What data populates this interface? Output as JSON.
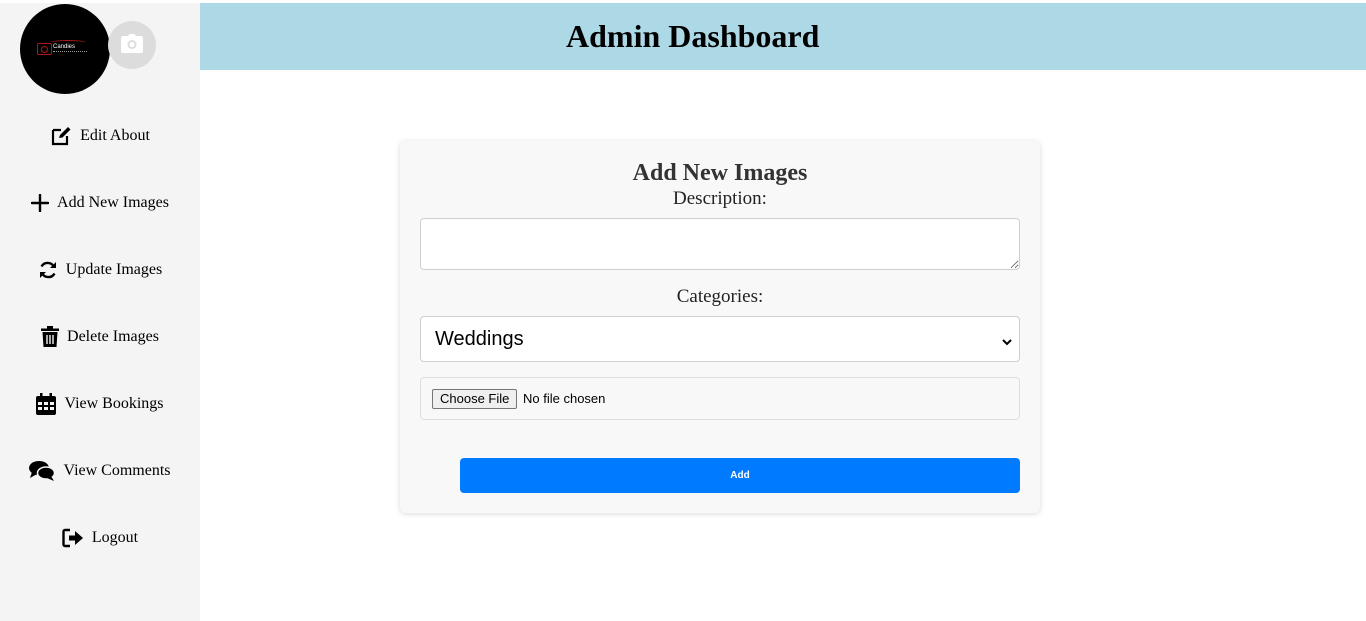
{
  "header": {
    "title": "Admin Dashboard"
  },
  "sidebar": {
    "logo": {
      "text": "Candies",
      "icon": "camera-logo"
    },
    "avatar": {
      "icon": "camera-icon"
    },
    "items": [
      {
        "label": "Edit About",
        "icon": "edit-icon"
      },
      {
        "label": "Add New Images",
        "icon": "plus-icon"
      },
      {
        "label": "Update Images",
        "icon": "refresh-icon"
      },
      {
        "label": "Delete Images",
        "icon": "trash-icon"
      },
      {
        "label": "View Bookings",
        "icon": "calendar-icon"
      },
      {
        "label": "View Comments",
        "icon": "comments-icon"
      },
      {
        "label": "Logout",
        "icon": "logout-icon"
      }
    ]
  },
  "form": {
    "title": "Add New Images",
    "description_label": "Description:",
    "description_value": "",
    "categories_label": "Categories:",
    "category_selected": "Weddings",
    "file_button": "Choose File",
    "file_status": "No file chosen",
    "submit_label": "Add"
  },
  "colors": {
    "header_bg": "#add8e6",
    "sidebar_bg": "#f4f4f4",
    "primary": "#007bff"
  }
}
